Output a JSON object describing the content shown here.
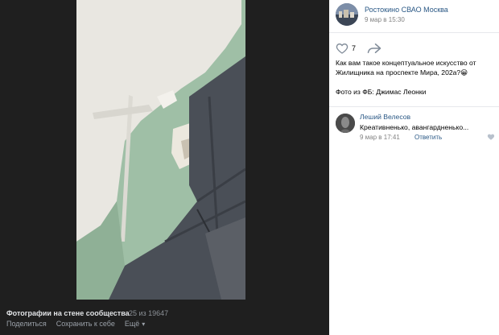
{
  "footer": {
    "title": "Фотографии на стене сообщества",
    "count": "25 из 19647",
    "share": "Поделиться",
    "save": "Сохранить к себе",
    "more": "Ещё",
    "more_icon": "chevron-down-icon"
  },
  "post": {
    "group_name": "Ростокино СВАО Москва",
    "date": "9 мар в 15:30",
    "likes": "7",
    "text_line1": "Как вам такое концептуальное искусство от",
    "text_line2": "Жилищника на проспекте Мира, 202а?😀",
    "credit": "Фото из ФБ: Джимас Леонки"
  },
  "comment": {
    "author": "Леший Велесов",
    "text": "Креативненько, авангардненько...",
    "date": "9 мар в 17:41",
    "reply": "Ответить"
  },
  "colors": {
    "link": "#2a5885",
    "viewer_bg": "#1f1f1f",
    "wall_white": "#e9e7e1",
    "wall_green": "#9fbfa6",
    "tile": "#4a4f57"
  }
}
